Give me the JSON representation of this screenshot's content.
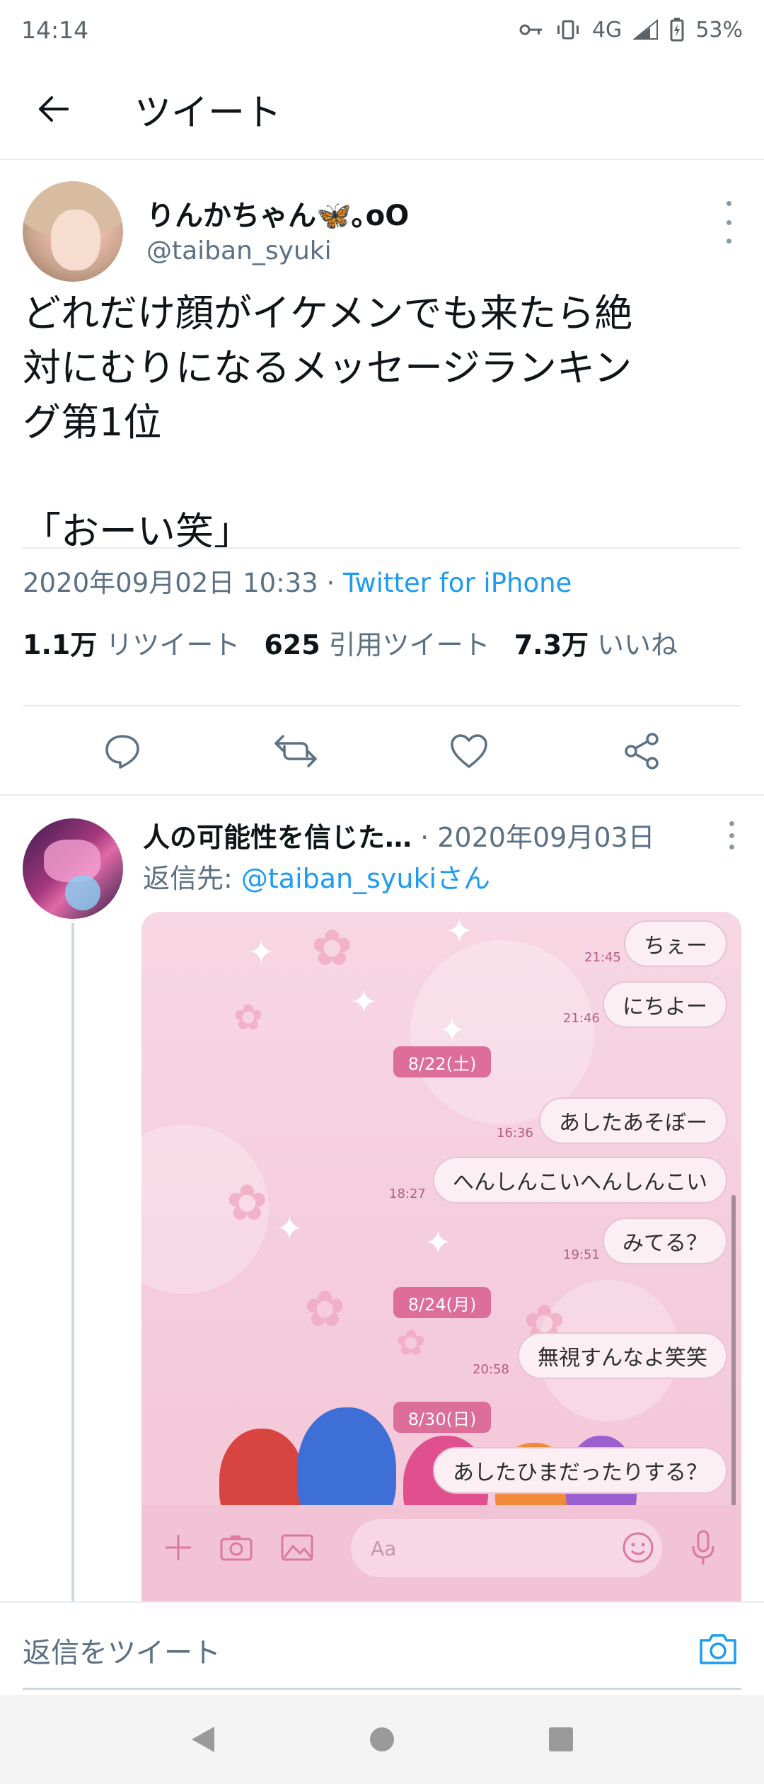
{
  "status_bar": {
    "time": "14:14",
    "network": "4G",
    "battery": "53%"
  },
  "header": {
    "title": "ツイート"
  },
  "tweet": {
    "author_name": "りんかちゃん🦋｡oO",
    "author_handle": "@taiban_syuki",
    "text": "どれだけ顔がイケメンでも来たら絶\n対にむりになるメッセージランキン\nグ第1位\n\n「おーい笑」",
    "date": "2020年09月02日 10:33",
    "separator": " · ",
    "via": "Twitter for iPhone",
    "stats": {
      "retweets": "1.1万",
      "retweets_label": "リツイート",
      "quotes": "625",
      "quotes_label": "引用ツイート",
      "likes": "7.3万",
      "likes_label": "いいね"
    }
  },
  "reply": {
    "author_name": "人の可能性を信じた…",
    "date": " · 2020年09月03日",
    "reply_to_prefix": "返信先: ",
    "reply_to_mention": "@taiban_syukiさん",
    "chat": {
      "messages": [
        {
          "text": "ちぇー",
          "time": "21:45"
        },
        {
          "text": "にちよー",
          "time": "21:46"
        },
        {
          "text": "あしたあそぼー",
          "time": "16:36"
        },
        {
          "text": "へんしんこいへんしんこい",
          "time": "18:27"
        },
        {
          "text": "みてる？",
          "time": "19:51"
        },
        {
          "text": "無視すんなよ笑笑",
          "time": "20:58"
        },
        {
          "text": "あしたひまだったりする？",
          "time": ""
        }
      ],
      "dates": [
        "8/22(土)",
        "8/24(月)",
        "8/30(日)"
      ],
      "input_placeholder": "Aa"
    }
  },
  "reply_bar": {
    "placeholder": "返信をツイート"
  },
  "colors": {
    "accent": "#1d9bf0",
    "muted": "#5b7083",
    "chat_pink": "#dd6d99"
  }
}
